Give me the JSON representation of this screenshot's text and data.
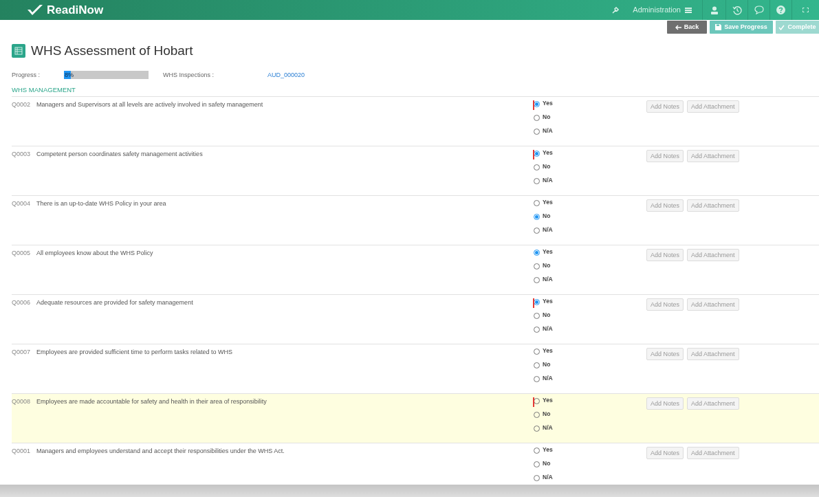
{
  "app": {
    "name": "ReadiNow",
    "nav_label": "Administration"
  },
  "toolbar": {
    "buttons": [
      {
        "label": "Back",
        "kind": "back"
      },
      {
        "label": "Save Progress",
        "kind": "save"
      },
      {
        "label": "Complete",
        "kind": "complete"
      }
    ]
  },
  "title": "WHS Assessment of Hobart",
  "progress": {
    "label": "Progress :",
    "level": 0.08,
    "reading": "8%"
  },
  "inspection": {
    "label": "WHS Inspections :",
    "link": "AUD_000020"
  },
  "section": "WHS MANAGEMENT",
  "questions": [
    {
      "code": "Q0002",
      "text": "Managers and Supervisors at all levels are actively involved in safety management",
      "flagged": true,
      "highlighted": false,
      "options": [
        {
          "label": "Yes",
          "selected": true
        },
        {
          "label": "No",
          "selected": false
        },
        {
          "label": "N/A",
          "selected": false
        }
      ],
      "buttons": [
        "Add Notes",
        "Add Attachment"
      ]
    },
    {
      "code": "Q0003",
      "text": "Competent person coordinates safety management activities",
      "flagged": true,
      "highlighted": false,
      "options": [
        {
          "label": "Yes",
          "selected": true
        },
        {
          "label": "No",
          "selected": false
        },
        {
          "label": "N/A",
          "selected": false
        }
      ],
      "buttons": [
        "Add Notes",
        "Add Attachment"
      ]
    },
    {
      "code": "Q0004",
      "text": "There is an up-to-date WHS Policy in your area",
      "flagged": false,
      "highlighted": false,
      "options": [
        {
          "label": "Yes",
          "selected": false
        },
        {
          "label": "No",
          "selected": true
        },
        {
          "label": "N/A",
          "selected": false
        }
      ],
      "buttons": [
        "Add Notes",
        "Add Attachment"
      ]
    },
    {
      "code": "Q0005",
      "text": "All employees know about the WHS Policy",
      "flagged": false,
      "highlighted": false,
      "options": [
        {
          "label": "Yes",
          "selected": true
        },
        {
          "label": "No",
          "selected": false
        },
        {
          "label": "N/A",
          "selected": false
        }
      ],
      "buttons": [
        "Add Notes",
        "Add Attachment"
      ]
    },
    {
      "code": "Q0006",
      "text": "Adequate resources are provided for safety management",
      "flagged": true,
      "highlighted": false,
      "options": [
        {
          "label": "Yes",
          "selected": true
        },
        {
          "label": "No",
          "selected": false
        },
        {
          "label": "N/A",
          "selected": false
        }
      ],
      "buttons": [
        "Add Notes",
        "Add Attachment"
      ]
    },
    {
      "code": "Q0007",
      "text": "Employees are provided sufficient time to perform tasks related to WHS",
      "flagged": false,
      "highlighted": false,
      "options": [
        {
          "label": "Yes",
          "selected": false
        },
        {
          "label": "No",
          "selected": false
        },
        {
          "label": "N/A",
          "selected": false
        }
      ],
      "buttons": [
        "Add Notes",
        "Add Attachment"
      ]
    },
    {
      "code": "Q0008",
      "text": "Employees are made accountable for safety and health in their area of responsibility",
      "flagged": true,
      "highlighted": true,
      "options": [
        {
          "label": "Yes",
          "selected": false
        },
        {
          "label": "No",
          "selected": false
        },
        {
          "label": "N/A",
          "selected": false
        }
      ],
      "buttons": [
        "Add Notes",
        "Add Attachment"
      ]
    },
    {
      "code": "Q0001",
      "text": "Managers and employees understand and accept their responsibilities under the WHS Act.",
      "flagged": false,
      "highlighted": false,
      "options": [
        {
          "label": "Yes",
          "selected": false
        },
        {
          "label": "No",
          "selected": false
        },
        {
          "label": "N/A",
          "selected": false
        }
      ],
      "buttons": [
        "Add Notes",
        "Add Attachment"
      ]
    }
  ]
}
